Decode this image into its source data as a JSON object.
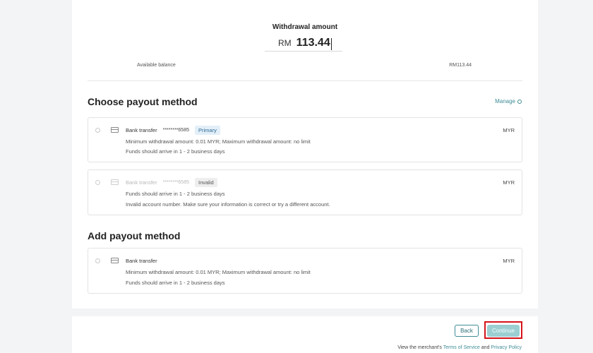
{
  "withdrawal": {
    "title": "Withdrawal amount",
    "currency_prefix": "RM",
    "amount": "113.44"
  },
  "balance": {
    "label": "Available balance",
    "value": "RM113.44"
  },
  "payout": {
    "title": "Choose payout method",
    "manage_label": "Manage",
    "methods": [
      {
        "name": "Bank transfer",
        "account": "********6585",
        "badge": "Primary",
        "currency": "MYR",
        "details": [
          "Minimum withdrawal amount: 0.01 MYR; Maximum withdrawal amount: no limit",
          "Funds should arrive in 1 - 2 business days"
        ]
      },
      {
        "name": "Bank transfer",
        "account": "********6585",
        "badge": "Invalid",
        "currency": "MYR",
        "details": [
          "Funds should arrive in 1 - 2 business days",
          "Invalid account number. Make sure your information is correct or try a different account."
        ]
      }
    ]
  },
  "add_payout": {
    "title": "Add payout method",
    "methods": [
      {
        "name": "Bank transfer",
        "currency": "MYR",
        "details": [
          "Minimum withdrawal amount: 0.01 MYR; Maximum withdrawal amount: no limit",
          "Funds should arrive in 1 - 2 business days"
        ]
      }
    ]
  },
  "footer": {
    "back_label": "Back",
    "continue_label": "Continue",
    "legal_prefix": "View the merchant's",
    "terms_label": "Terms of Service",
    "and_text": "and",
    "privacy_label": "Privacy Policy"
  },
  "colors": {
    "accent": "#3f8d96",
    "highlight_border": "#d4141a",
    "continue_bg": "#9ccfd2"
  }
}
